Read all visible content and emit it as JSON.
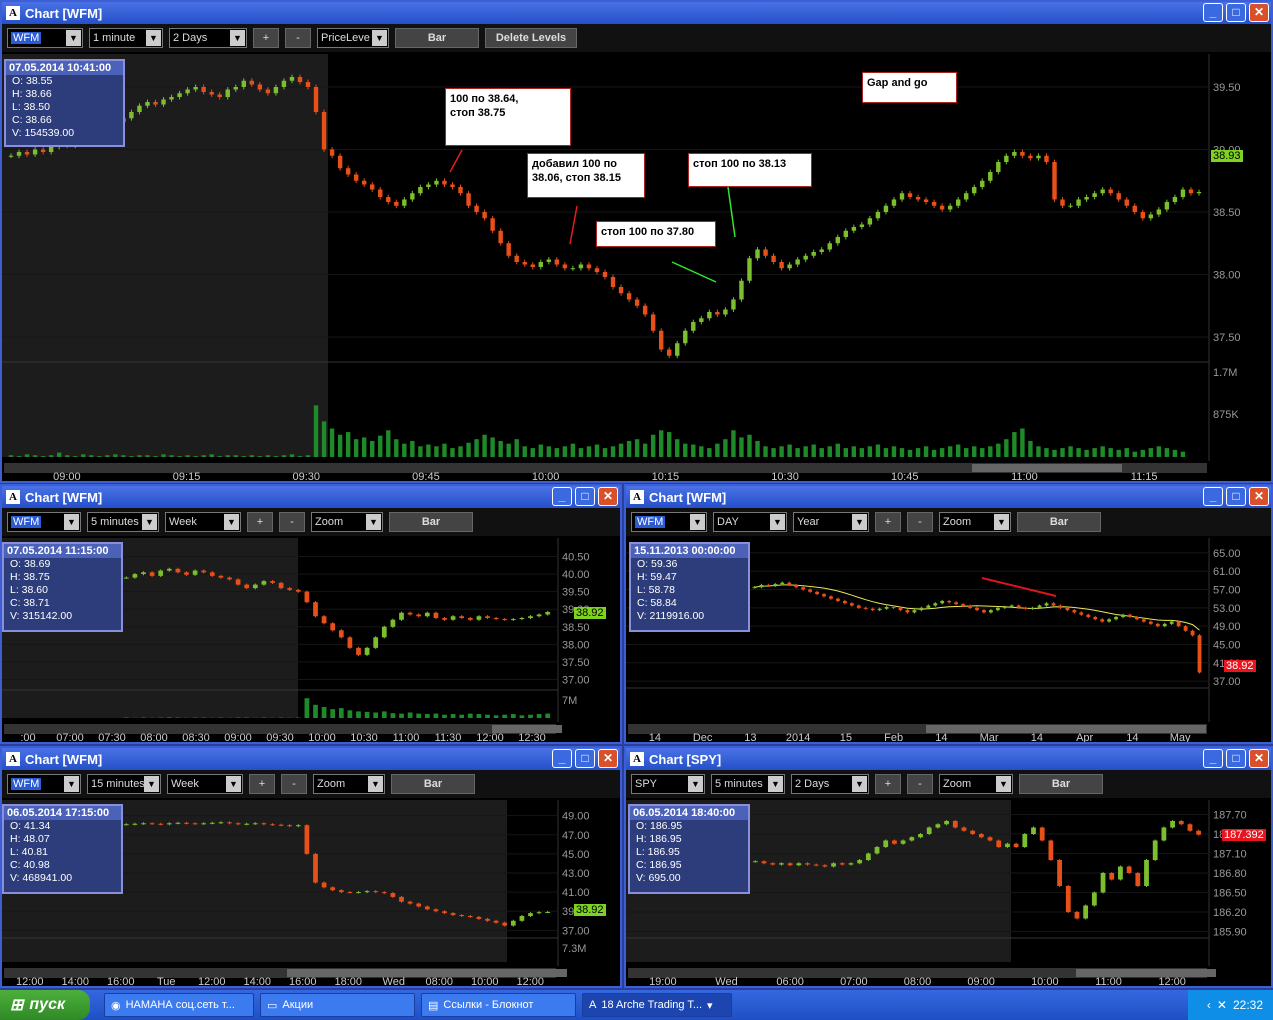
{
  "colors": {
    "up": "#7cbf2e",
    "down": "#e8501a",
    "volume": "#1f8a2a",
    "ma": "#e8e858",
    "redline": "#e0141e",
    "pricetag_green": "#7ed321",
    "pricetag_red": "#e8141e"
  },
  "icons": {
    "minimize": "minimize-icon",
    "maximize": "maximize-icon",
    "close": "close-icon",
    "app": "arche-app-icon"
  },
  "win_main": {
    "title": "Chart [WFM]",
    "toolbar": {
      "symbol": "WFM",
      "interval": "1 minute",
      "range": "2 Days",
      "plus": "+",
      "minus": "-",
      "mode": "PriceLeve",
      "bar": "Bar",
      "delete": "Delete Levels"
    },
    "info": {
      "date": "07.05.2014 10:41:00",
      "o": "O: 38.55",
      "h": "H: 38.66",
      "l": "L: 38.50",
      "c": "C: 38.66",
      "v": "V: 154539.00"
    },
    "annotations": [
      {
        "text": "100 по 38.64,\nстоп 38.75"
      },
      {
        "text": "добавил 100 по\n38.06, стоп 38.15"
      },
      {
        "text": "стоп 100 по 37.80"
      },
      {
        "text": "стоп 100 по 38.13"
      },
      {
        "text": "Gap and go"
      }
    ],
    "price_tag": "38.93",
    "chart_data": {
      "type": "candlestick",
      "yticks": [
        "39.50",
        "39.00",
        "38.50",
        "38.00",
        "37.50"
      ],
      "volticks": [
        "1.7M",
        "875K"
      ],
      "xticks": [
        "09:00",
        "09:15",
        "09:30",
        "09:45",
        "10:00",
        "10:15",
        "10:30",
        "10:45",
        "11:00",
        "11:15"
      ],
      "closes": [
        38.95,
        38.98,
        38.96,
        39.0,
        38.98,
        39.02,
        39.05,
        39.03,
        39.08,
        39.12,
        39.15,
        39.2,
        39.18,
        39.22,
        39.25,
        39.3,
        39.35,
        39.38,
        39.36,
        39.4,
        39.42,
        39.45,
        39.48,
        39.5,
        39.46,
        39.44,
        39.42,
        39.48,
        39.5,
        39.55,
        39.52,
        39.48,
        39.45,
        39.5,
        39.55,
        39.58,
        39.54,
        39.5,
        39.3,
        39.0,
        38.95,
        38.85,
        38.8,
        38.75,
        38.72,
        38.68,
        38.62,
        38.58,
        38.55,
        38.6,
        38.65,
        38.7,
        38.72,
        38.75,
        38.72,
        38.7,
        38.65,
        38.55,
        38.5,
        38.45,
        38.35,
        38.25,
        38.15,
        38.1,
        38.08,
        38.06,
        38.1,
        38.12,
        38.08,
        38.05,
        38.05,
        38.08,
        38.05,
        38.02,
        37.98,
        37.9,
        37.85,
        37.8,
        37.75,
        37.68,
        37.55,
        37.4,
        37.35,
        37.45,
        37.55,
        37.62,
        37.65,
        37.7,
        37.68,
        37.72,
        37.8,
        37.95,
        38.13,
        38.2,
        38.15,
        38.1,
        38.05,
        38.08,
        38.12,
        38.15,
        38.18,
        38.2,
        38.25,
        38.3,
        38.35,
        38.38,
        38.4,
        38.45,
        38.5,
        38.55,
        38.6,
        38.65,
        38.62,
        38.6,
        38.58,
        38.55,
        38.52,
        38.55,
        38.6,
        38.65,
        38.7,
        38.75,
        38.82,
        38.9,
        38.95,
        38.98,
        38.95,
        38.93,
        38.95,
        38.9,
        38.6,
        38.55,
        38.55,
        38.6,
        38.62,
        38.65,
        38.68,
        38.65,
        38.6,
        38.55,
        38.5,
        38.45,
        38.48,
        38.52,
        38.58,
        38.62,
        38.68,
        38.65,
        38.66
      ],
      "volumes": [
        0.02,
        0.01,
        0.03,
        0.02,
        0.01,
        0.02,
        0.05,
        0.02,
        0.01,
        0.03,
        0.02,
        0.01,
        0.02,
        0.03,
        0.02,
        0.01,
        0.02,
        0.02,
        0.01,
        0.03,
        0.02,
        0.01,
        0.02,
        0.01,
        0.02,
        0.03,
        0.01,
        0.02,
        0.02,
        0.01,
        0.02,
        0.01,
        0.02,
        0.01,
        0.02,
        0.03,
        0.01,
        0.02,
        0.58,
        0.4,
        0.32,
        0.25,
        0.28,
        0.2,
        0.22,
        0.18,
        0.24,
        0.3,
        0.2,
        0.15,
        0.18,
        0.12,
        0.14,
        0.12,
        0.15,
        0.1,
        0.12,
        0.16,
        0.2,
        0.25,
        0.22,
        0.18,
        0.15,
        0.2,
        0.12,
        0.1,
        0.14,
        0.12,
        0.1,
        0.12,
        0.15,
        0.1,
        0.12,
        0.14,
        0.1,
        0.12,
        0.15,
        0.18,
        0.2,
        0.15,
        0.25,
        0.3,
        0.28,
        0.2,
        0.15,
        0.14,
        0.12,
        0.1,
        0.15,
        0.2,
        0.3,
        0.22,
        0.25,
        0.18,
        0.12,
        0.1,
        0.12,
        0.14,
        0.1,
        0.12,
        0.14,
        0.1,
        0.12,
        0.15,
        0.1,
        0.12,
        0.1,
        0.12,
        0.14,
        0.1,
        0.12,
        0.1,
        0.08,
        0.1,
        0.12,
        0.08,
        0.1,
        0.12,
        0.14,
        0.1,
        0.12,
        0.1,
        0.12,
        0.15,
        0.2,
        0.28,
        0.32,
        0.18,
        0.12,
        0.1,
        0.08,
        0.1,
        0.12,
        0.1,
        0.08,
        0.1,
        0.12,
        0.1,
        0.08,
        0.1,
        0.06,
        0.08,
        0.1,
        0.12,
        0.1,
        0.08,
        0.06
      ]
    }
  },
  "win_5m": {
    "title": "Chart [WFM]",
    "toolbar": {
      "symbol": "WFM",
      "interval": "5 minutes",
      "range": "Week",
      "plus": "+",
      "minus": "-",
      "mode": "Zoom",
      "bar": "Bar"
    },
    "info": {
      "date": "07.05.2014 11:15:00",
      "o": "O: 38.69",
      "h": "H: 38.75",
      "l": "L: 38.60",
      "c": "C: 38.71",
      "v": "V: 315142.00"
    },
    "price_tag": "38.92",
    "chart_data": {
      "type": "candlestick",
      "yticks": [
        "40.50",
        "40.00",
        "39.50",
        "39.00",
        "38.50",
        "38.00",
        "37.50",
        "37.00"
      ],
      "volticks": [
        "7M"
      ],
      "xticks": [
        ":00",
        "07:00",
        "07:30",
        "08:00",
        "08:30",
        "09:00",
        "09:30",
        "10:00",
        "10:30",
        "11:00",
        "11:30",
        "12:00",
        "12:30"
      ],
      "closes": [
        39.9,
        40.0,
        40.05,
        39.95,
        40.1,
        40.15,
        40.05,
        39.98,
        40.1,
        40.05,
        39.95,
        39.9,
        39.85,
        39.7,
        39.6,
        39.7,
        39.8,
        39.75,
        39.6,
        39.55,
        39.5,
        39.2,
        38.8,
        38.6,
        38.4,
        38.2,
        37.9,
        37.7,
        37.9,
        38.2,
        38.5,
        38.7,
        38.9,
        38.85,
        38.8,
        38.9,
        38.75,
        38.7,
        38.8,
        38.75,
        38.7,
        38.8,
        38.75,
        38.72,
        38.7,
        38.72,
        38.75,
        38.8,
        38.85,
        38.92
      ],
      "volumes": [
        0.02,
        0.01,
        0.02,
        0.01,
        0.02,
        0.03,
        0.02,
        0.01,
        0.02,
        0.02,
        0.01,
        0.02,
        0.01,
        0.02,
        0.02,
        0.01,
        0.02,
        0.01,
        0.02,
        0.01,
        0.02,
        0.9,
        0.6,
        0.5,
        0.4,
        0.45,
        0.35,
        0.3,
        0.28,
        0.25,
        0.3,
        0.22,
        0.2,
        0.25,
        0.2,
        0.18,
        0.2,
        0.15,
        0.18,
        0.15,
        0.2,
        0.18,
        0.15,
        0.12,
        0.15,
        0.18,
        0.12,
        0.15,
        0.18,
        0.2
      ]
    }
  },
  "win_day": {
    "title": "Chart [WFM]",
    "toolbar": {
      "symbol": "WFM",
      "interval": "DAY",
      "range": "Year",
      "plus": "+",
      "minus": "-",
      "mode": "Zoom",
      "bar": "Bar"
    },
    "info": {
      "date": "15.11.2013 00:00:00",
      "o": "O: 59.36",
      "h": "H: 59.47",
      "l": "L: 58.78",
      "c": "C: 58.84",
      "v": "V: 2119916.00"
    },
    "price_tag": "38.92",
    "chart_data": {
      "type": "candlestick",
      "yticks": [
        "65.00",
        "61.00",
        "57.00",
        "53.00",
        "49.00",
        "45.00",
        "41.00",
        "37.00"
      ],
      "xticks": [
        "14",
        "Dec",
        "13",
        "2014",
        "15",
        "Feb",
        "14",
        "Mar",
        "14",
        "Apr",
        "14",
        "May"
      ],
      "closes": [
        57.5,
        58.0,
        57.8,
        58.2,
        58.5,
        58.0,
        57.5,
        57.0,
        56.5,
        56.0,
        55.5,
        55.0,
        54.5,
        54.0,
        53.5,
        53.0,
        52.8,
        52.5,
        52.8,
        53.2,
        53.0,
        52.5,
        52.0,
        52.5,
        53.0,
        53.5,
        54.0,
        54.5,
        54.2,
        53.8,
        53.5,
        53.0,
        52.5,
        52.0,
        52.5,
        53.0,
        53.2,
        53.5,
        53.0,
        52.8,
        53.0,
        53.5,
        54.0,
        53.5,
        53.0,
        52.5,
        52.0,
        51.5,
        51.0,
        50.5,
        50.0,
        50.5,
        51.0,
        51.5,
        51.0,
        50.5,
        50.0,
        49.5,
        49.0,
        49.5,
        50.0,
        49.0,
        48.0,
        47.0,
        38.9
      ]
    }
  },
  "win_15m": {
    "title": "Chart [WFM]",
    "toolbar": {
      "symbol": "WFM",
      "interval": "15 minutes",
      "range": "Week",
      "plus": "+",
      "minus": "-",
      "mode": "Zoom",
      "bar": "Bar"
    },
    "info": {
      "date": "06.05.2014 17:15:00",
      "o": "O: 41.34",
      "h": "H: 48.07",
      "l": "L: 40.81",
      "c": "C: 40.98",
      "v": "V: 468941.00"
    },
    "price_tag": "38.92",
    "chart_data": {
      "type": "candlestick",
      "yticks": [
        "49.00",
        "47.00",
        "45.00",
        "43.00",
        "41.00",
        "39.00",
        "37.00"
      ],
      "volticks": [
        "7.3M"
      ],
      "xticks": [
        "12:00",
        "14:00",
        "16:00",
        "Tue",
        "12:00",
        "14:00",
        "16:00",
        "18:00",
        "Wed",
        "08:00",
        "10:00",
        "12:00"
      ],
      "closes": [
        48.1,
        48.15,
        48.2,
        48.15,
        48.1,
        48.2,
        48.25,
        48.2,
        48.15,
        48.2,
        48.25,
        48.3,
        48.2,
        48.1,
        48.15,
        48.2,
        48.1,
        48.05,
        48.0,
        47.9,
        48.0,
        45.0,
        42.0,
        41.5,
        41.2,
        41.0,
        40.98,
        41.0,
        41.1,
        41.0,
        40.9,
        40.5,
        40.0,
        39.8,
        39.5,
        39.2,
        39.0,
        38.8,
        38.6,
        38.5,
        38.4,
        38.2,
        38.0,
        37.8,
        37.5,
        38.0,
        38.5,
        38.8,
        38.9,
        38.92
      ]
    }
  },
  "win_spy": {
    "title": "Chart [SPY]",
    "toolbar": {
      "symbol": "SPY",
      "interval": "5 minutes",
      "range": "2 Days",
      "plus": "+",
      "minus": "-",
      "mode": "Zoom",
      "bar": "Bar"
    },
    "info": {
      "date": "06.05.2014 18:40:00",
      "o": "O: 186.95",
      "h": "H: 186.95",
      "l": "L: 186.95",
      "c": "C: 186.95",
      "v": "V: 695.00"
    },
    "price_tag": "187.392",
    "chart_data": {
      "type": "candlestick",
      "yticks": [
        "187.70",
        "187.40",
        "187.10",
        "186.80",
        "186.50",
        "186.20",
        "185.90"
      ],
      "xticks": [
        "19:00",
        "Wed",
        "06:00",
        "07:00",
        "08:00",
        "09:00",
        "10:00",
        "11:00",
        "12:00"
      ],
      "closes": [
        186.98,
        186.95,
        186.93,
        186.95,
        186.92,
        186.95,
        186.93,
        186.92,
        186.9,
        186.95,
        186.93,
        186.95,
        187.0,
        187.1,
        187.2,
        187.3,
        187.25,
        187.3,
        187.35,
        187.4,
        187.5,
        187.55,
        187.6,
        187.5,
        187.45,
        187.4,
        187.35,
        187.3,
        187.2,
        187.25,
        187.2,
        187.4,
        187.5,
        187.3,
        187.0,
        186.6,
        186.2,
        186.1,
        186.3,
        186.5,
        186.8,
        186.7,
        186.9,
        186.8,
        186.6,
        187.0,
        187.3,
        187.5,
        187.6,
        187.55,
        187.45,
        187.39
      ]
    }
  },
  "taskbar": {
    "start": "пуск",
    "items": [
      {
        "label": "НАМАНА соц.сеть т...",
        "icon": "chrome-icon"
      },
      {
        "label": "Акции",
        "icon": "folder-icon"
      },
      {
        "label": "Ссылки - Блокнот",
        "icon": "notepad-icon"
      },
      {
        "label": "18 Arche Trading T...",
        "icon": "arche-app-icon"
      }
    ],
    "time": "22:32"
  }
}
